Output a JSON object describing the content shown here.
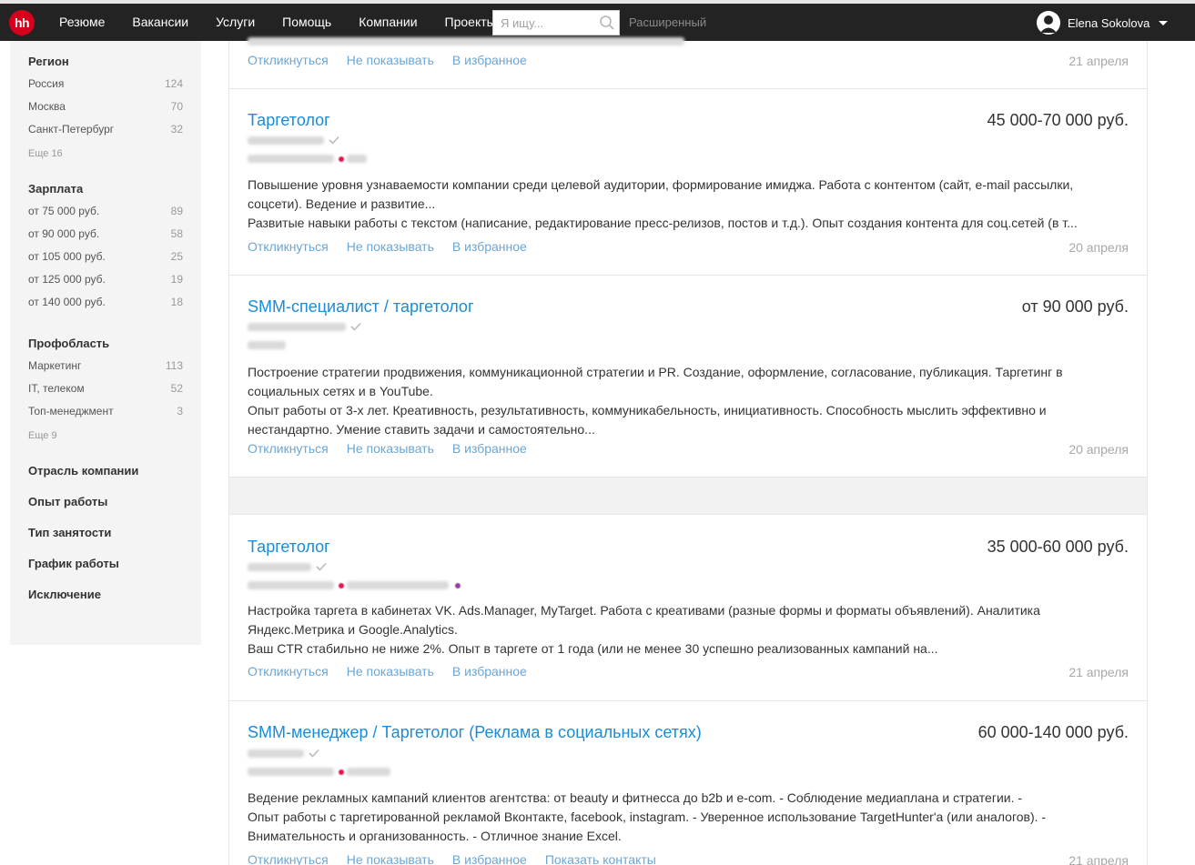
{
  "header": {
    "logo": "hh",
    "nav": [
      "Резюме",
      "Вакансии",
      "Услуги",
      "Помощь",
      "Компании",
      "Проекты"
    ],
    "search_placeholder": "Я ищу...",
    "advanced_label": "Расширенный",
    "user_name": "Elena Sokolova"
  },
  "sidebar": {
    "region": {
      "title": "Регион",
      "items": [
        {
          "label": "Россия",
          "count": "124"
        },
        {
          "label": "Москва",
          "count": "70"
        },
        {
          "label": "Санкт-Петербург",
          "count": "32"
        }
      ],
      "more": "Еще 16"
    },
    "salary": {
      "title": "Зарплата",
      "items": [
        {
          "label": "от 75 000 руб.",
          "count": "89"
        },
        {
          "label": "от 90 000 руб.",
          "count": "58"
        },
        {
          "label": "от 105 000 руб.",
          "count": "25"
        },
        {
          "label": "от 125 000 руб.",
          "count": "19"
        },
        {
          "label": "от 140 000 руб.",
          "count": "18"
        }
      ]
    },
    "prof": {
      "title": "Профобласть",
      "items": [
        {
          "label": "Маркетинг",
          "count": "113"
        },
        {
          "label": "IT, телеком",
          "count": "52"
        },
        {
          "label": "Топ-менеджмент",
          "count": "3"
        }
      ],
      "more": "Еще 9"
    },
    "sections": [
      "Отрасль компании",
      "Опыт работы",
      "Тип занятости",
      "График работы",
      "Исключение"
    ]
  },
  "actions": {
    "respond": "Откликнуться",
    "hide": "Не показывать",
    "favorite": "В избранное",
    "contacts": "Показать контакты"
  },
  "vacancies": [
    {
      "date": "21 апреля"
    },
    {
      "title": "Таргетолог",
      "salary": "45 000-70 000 руб.",
      "desc1": "Повышение уровня узнаваемости компании среди целевой аудитории, формирование имиджа. Работа с контентом (сайт, e-mail рассылки, соцсети). Ведение и развитие...",
      "desc2": "Развитые навыки работы с текстом (написание, редактирование пресс-релизов, постов и т.д.). Опыт создания контента для соц.сетей (в т...",
      "date": "20 апреля"
    },
    {
      "title": "SMM-специалист / таргетолог",
      "salary": "от 90 000 руб.",
      "desc1": "Построение стратегии продвижения, коммуникационной стратегии и PR. Создание, оформление, согласование, публикация. Таргетинг в социальных сетях и в YouTube.",
      "desc2": "Опыт работы от 3-х лет. Креативность, результативность, коммуникабельность, инициативность. Способность мыслить эффективно и нестандартно. Умение ставить задачи и самостоятельно...",
      "date": "20 апреля"
    },
    {
      "title": "Таргетолог",
      "salary": "35 000-60 000 руб.",
      "desc1": "Настройка таргета в кабинетах VK. Ads.Manager, MyTarget. Работа с креативами (разные формы и форматы объявлений). Аналитика Яндекс.Метрика и Google.Analytics.",
      "desc2": "Ваш CTR стабильно не ниже 2%. Опыт в таргете от 1 года (или не менее 30 успешно реализованных кампаний на...",
      "date": "21 апреля"
    },
    {
      "title": "SMM-менеджер / Таргетолог (Реклама в социальных сетях)",
      "salary": "60 000-140 000 руб.",
      "desc1": "Ведение рекламных кампаний клиентов агентства: от beauty и фитнесса до b2b и e-com. - Соблюдение медиаплана и стратегии. -",
      "desc2": "Опыт работы с таргетированной рекламой Вконтакте, facebook, instagram. - Уверенное использование TargetHunter'а (или аналогов). - Внимательность и организованность. - Отличное знание Excel.",
      "date": "21 апреля"
    }
  ],
  "colors": {
    "brand_red": "#d6001c",
    "link_blue": "#1a8cd8",
    "action_blue": "#6aa6d6",
    "metro_red": "#e5174b",
    "metro_purple": "#8e3f9e"
  }
}
